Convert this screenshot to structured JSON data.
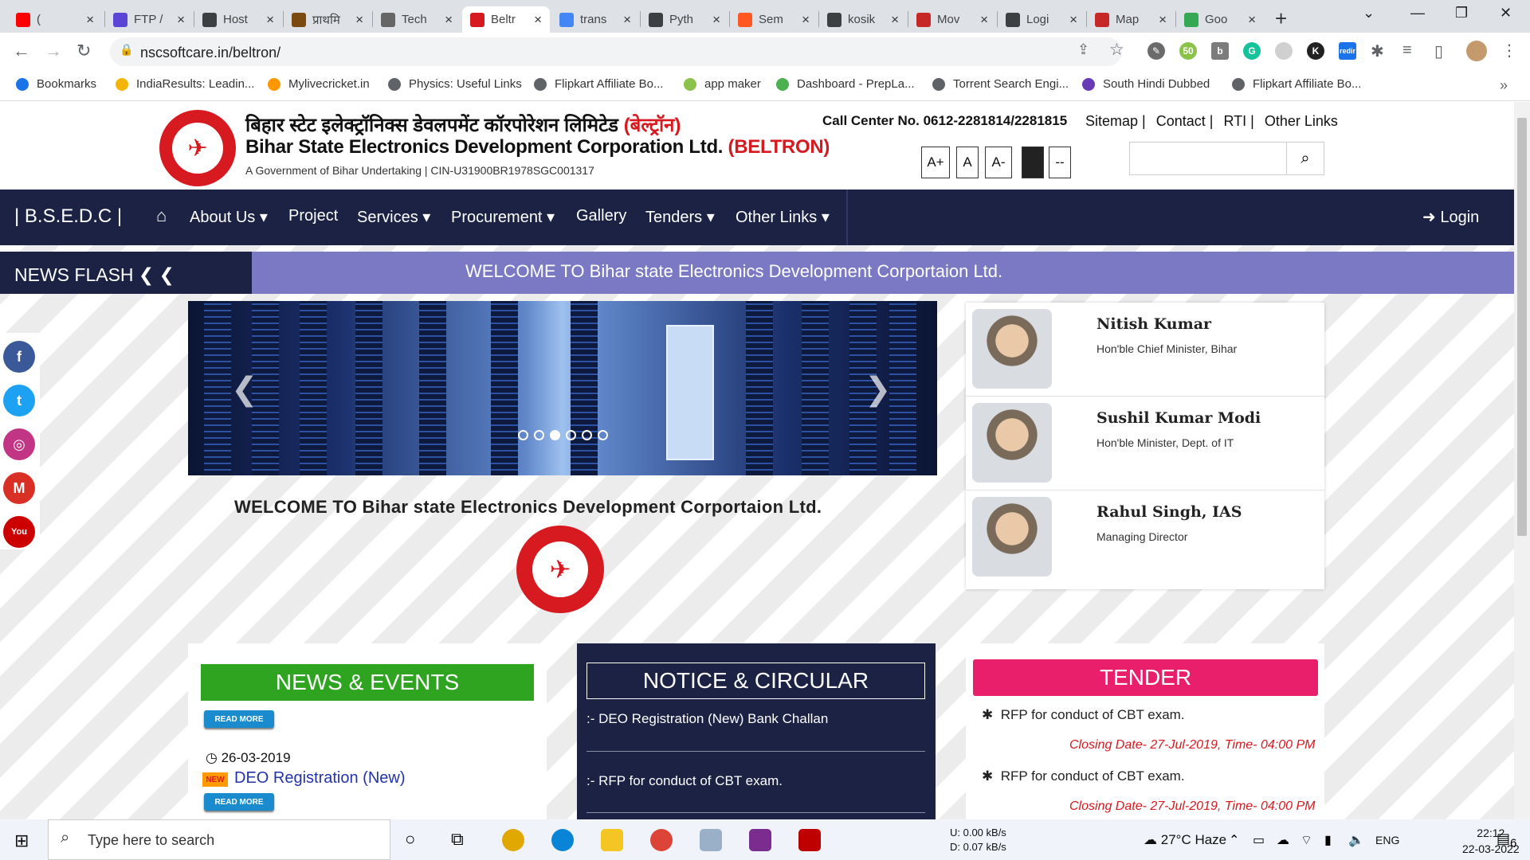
{
  "browser": {
    "tabs": [
      {
        "title": "(",
        "color": "#ff0000"
      },
      {
        "title": "FTP /",
        "color": "#5b45d6"
      },
      {
        "title": "Host",
        "color": "#3c4043"
      },
      {
        "title": "प्राथमि",
        "color": "#7a4a10"
      },
      {
        "title": "Tech",
        "color": "#666666"
      },
      {
        "title": "Beltr",
        "color": "#d71920"
      },
      {
        "title": "trans",
        "color": "#4285f4"
      },
      {
        "title": "Pyth",
        "color": "#3c4043"
      },
      {
        "title": "Sem",
        "color": "#ff5722"
      },
      {
        "title": "kosik",
        "color": "#3c4043"
      },
      {
        "title": "Mov",
        "color": "#c62828"
      },
      {
        "title": "Logi",
        "color": "#3c4043"
      },
      {
        "title": "Map",
        "color": "#c62828"
      },
      {
        "title": "Goo",
        "color": "#34a853"
      }
    ],
    "url": "nscsoftcare.in/beltron/",
    "bookmarks": [
      {
        "label": "Bookmarks",
        "color": "#1a73e8"
      },
      {
        "label": "IndiaResults: Leadin...",
        "color": "#f4b400"
      },
      {
        "label": "Mylivecricket.in",
        "color": "#ff9800"
      },
      {
        "label": "Physics: Useful Links",
        "color": "#5f6368"
      },
      {
        "label": "Flipkart Affiliate Bo...",
        "color": "#5f6368"
      },
      {
        "label": "app maker",
        "color": "#8bc34a"
      },
      {
        "label": "Dashboard - PrepLa...",
        "color": "#4caf50"
      },
      {
        "label": "Torrent Search Engi...",
        "color": "#5f6368"
      },
      {
        "label": "South Hindi Dubbed",
        "color": "#673ab7"
      },
      {
        "label": "Flipkart Affiliate Bo...",
        "color": "#5f6368"
      }
    ]
  },
  "header": {
    "hindi_name": "बिहार स्टेट इलेक्ट्रॉनिक्स डेवलपमेंट कॉरपोरेशन लिमिटेड",
    "hindi_tag": "(बेल्ट्रॉन)",
    "eng_name": "Bihar State Electronics Development Corporation Ltd.",
    "eng_tag": "(BELTRON)",
    "govt_line": "A Government of Bihar Undertaking | CIN-U31900BR1978SGC001317",
    "call_center": "Call Center No. 0612-2281814/2281815",
    "top_links": [
      "Sitemap |",
      "Contact |",
      "RTI |",
      "Other Links"
    ],
    "font_buttons": [
      "A+",
      "A",
      "A-",
      "--",
      "--"
    ],
    "search_placeholder": ""
  },
  "nav": {
    "brand": "| B.S.E.D.C |",
    "items": [
      "About Us ▾",
      "Project",
      "Services ▾",
      "Procurement ▾",
      "Gallery",
      "Tenders ▾",
      "Other Links ▾"
    ],
    "login": "Login"
  },
  "news_flash": {
    "label": "NEWS FLASH",
    "message": "WELCOME TO Bihar state Electronics Development Corportaion Ltd."
  },
  "welcome_text": "WELCOME TO Bihar state Electronics Development Corportaion Ltd.",
  "slider": {
    "dots": 6,
    "active_dot": 3
  },
  "people": [
    {
      "name": "Nitish Kumar",
      "title": "Hon'ble Chief Minister, Bihar"
    },
    {
      "name": "Sushil Kumar Modi",
      "title": "Hon'ble Minister, Dept. of IT"
    },
    {
      "name": "Rahul Singh, IAS",
      "title": "Managing Director"
    }
  ],
  "news_events": {
    "heading": "NEWS & EVENTS",
    "read_more": "READ MORE",
    "new_badge": "NEW",
    "date": "26-03-2019",
    "title": "DEO Registration (New)"
  },
  "notice": {
    "heading": "NOTICE & CIRCULAR",
    "items": [
      ":-  DEO Registration (New) Bank Challan",
      ":-  RFP for conduct of CBT exam."
    ]
  },
  "tender": {
    "heading": "TENDER",
    "items": [
      {
        "title": "RFP for conduct of CBT exam.",
        "closing": "Closing Date- 27-Jul-2019, Time- 04:00 PM"
      },
      {
        "title": "RFP for conduct of CBT exam.",
        "closing": "Closing Date- 27-Jul-2019, Time- 04:00 PM"
      }
    ]
  },
  "taskbar": {
    "search_placeholder": "Type here to search",
    "net_up": "U:   0.00 kB/s",
    "net_down": "D:   0.07 kB/s",
    "weather": "27°C  Haze",
    "lang": "ENG",
    "time": "22:12",
    "date": "22-03-2022",
    "notif_count": "6"
  }
}
